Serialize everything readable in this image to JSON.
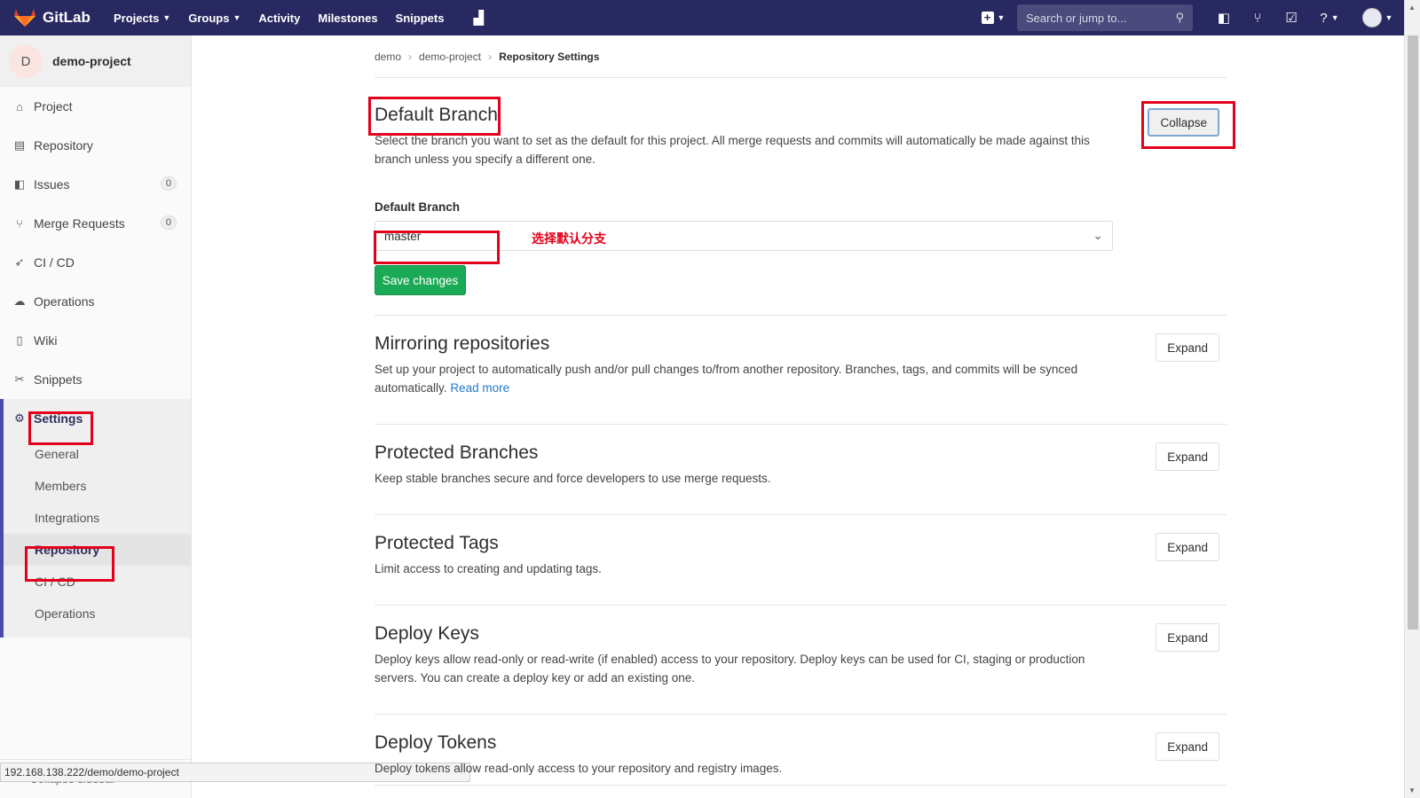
{
  "topnav": {
    "brand": "GitLab",
    "links": [
      {
        "label": "Projects",
        "dropdown": true
      },
      {
        "label": "Groups",
        "dropdown": true
      },
      {
        "label": "Activity",
        "dropdown": false
      },
      {
        "label": "Milestones",
        "dropdown": false
      },
      {
        "label": "Snippets",
        "dropdown": false
      }
    ],
    "search_placeholder": "Search or jump to...",
    "bg_color": "#292961"
  },
  "sidebar": {
    "project_initial": "D",
    "project_name": "demo-project",
    "items": [
      {
        "label": "Project",
        "icon": "home-icon",
        "sym": "⌂"
      },
      {
        "label": "Repository",
        "icon": "book-icon",
        "sym": "▤"
      },
      {
        "label": "Issues",
        "icon": "issues-icon",
        "sym": "◧",
        "badge": "0"
      },
      {
        "label": "Merge Requests",
        "icon": "merge-request-icon",
        "sym": "⑂",
        "badge": "0"
      },
      {
        "label": "CI / CD",
        "icon": "rocket-icon",
        "sym": "➶"
      },
      {
        "label": "Operations",
        "icon": "cloud-gear-icon",
        "sym": "☁"
      },
      {
        "label": "Wiki",
        "icon": "wiki-icon",
        "sym": "▯"
      },
      {
        "label": "Snippets",
        "icon": "scissors-icon",
        "sym": "✂"
      }
    ],
    "settings_label": "Settings",
    "settings_subitems": [
      "General",
      "Members",
      "Integrations",
      "Repository",
      "CI / CD",
      "Operations"
    ],
    "active_subitem": "Repository",
    "collapse_label": "Collapse sidebar"
  },
  "statusbar": {
    "url": "192.168.138.222/demo/demo-project"
  },
  "breadcrumb": [
    "demo",
    "demo-project",
    "Repository Settings"
  ],
  "default_branch": {
    "title": "Default Branch",
    "description": "Select the branch you want to set as the default for this project. All merge requests and commits will automatically be made against this branch unless you specify a different one.",
    "button": "Collapse",
    "field_label": "Default Branch",
    "selected_value": "master",
    "annotation": "选择默认分支",
    "save_label": "Save changes"
  },
  "sections": [
    {
      "title": "Mirroring repositories",
      "description": "Set up your project to automatically push and/or pull changes to/from another repository. Branches, tags, and commits will be synced automatically.",
      "link": "Read more",
      "button": "Expand"
    },
    {
      "title": "Protected Branches",
      "description": "Keep stable branches secure and force developers to use merge requests.",
      "button": "Expand"
    },
    {
      "title": "Protected Tags",
      "description": "Limit access to creating and updating tags.",
      "button": "Expand"
    },
    {
      "title": "Deploy Keys",
      "description": "Deploy keys allow read-only or read-write (if enabled) access to your repository. Deploy keys can be used for CI, staging or production servers. You can create a deploy key or add an existing one.",
      "button": "Expand"
    },
    {
      "title": "Deploy Tokens",
      "description": "Deploy tokens allow read-only access to your repository and registry images.",
      "button": "Expand"
    }
  ],
  "colors": {
    "annotation_red": "#e3001b",
    "save_green": "#1aaa55",
    "link_blue": "#1f78d1"
  }
}
